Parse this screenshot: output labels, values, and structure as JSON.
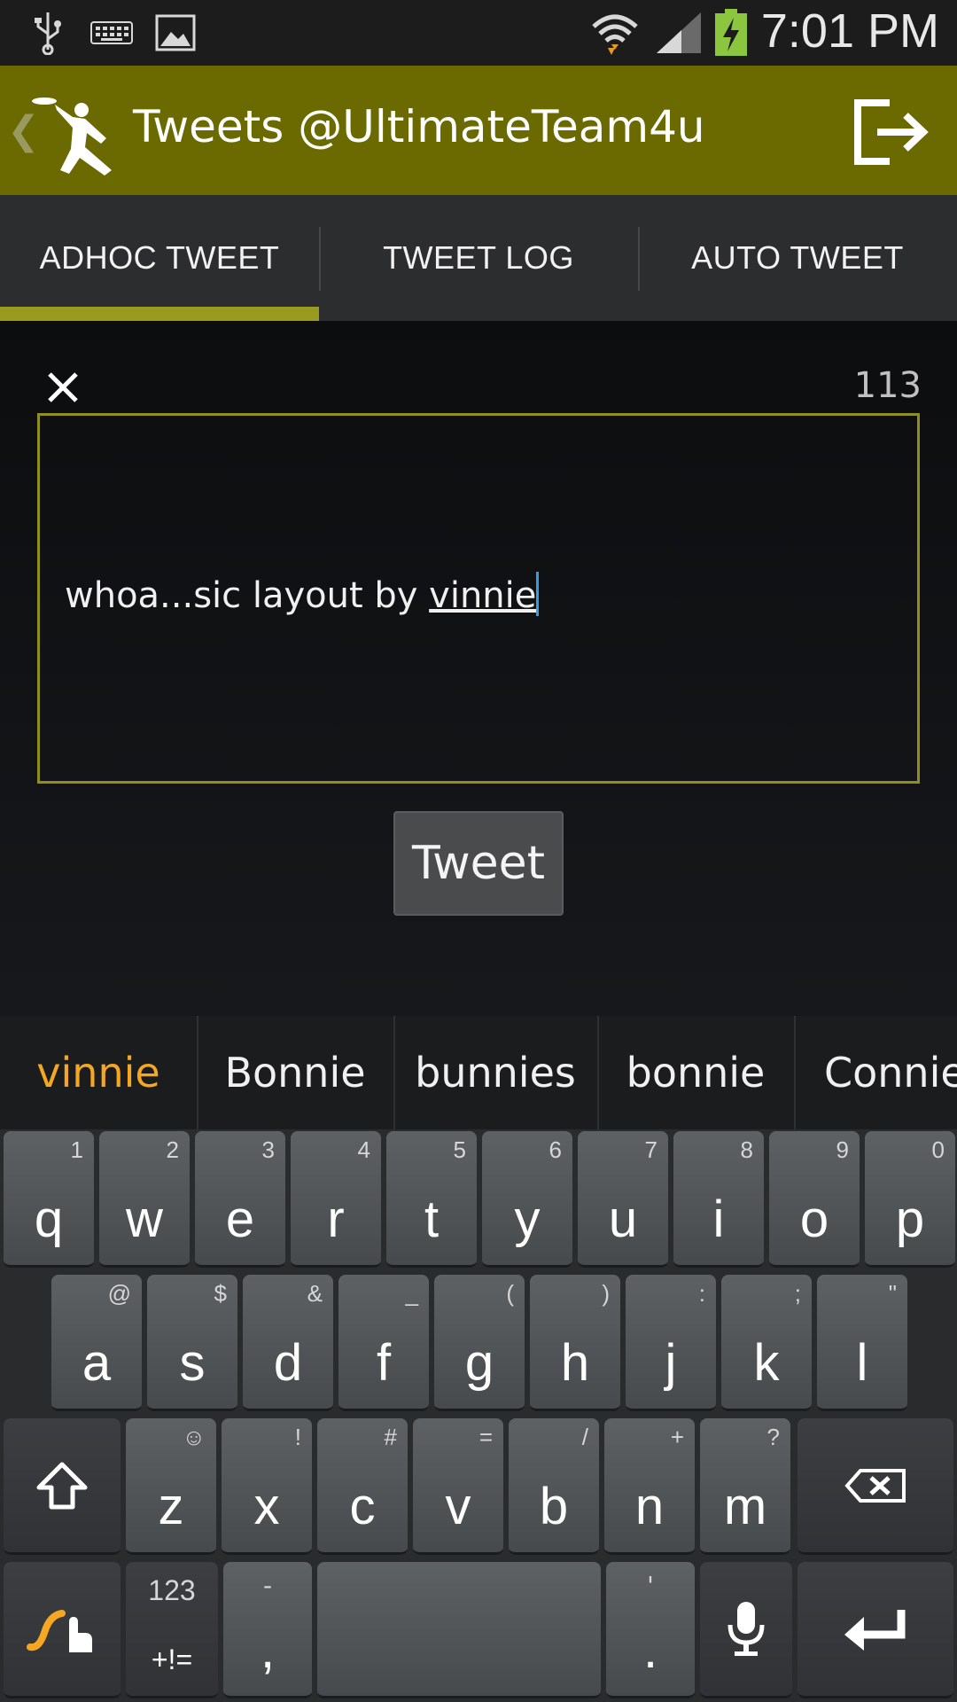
{
  "status_bar": {
    "time": "7:01 PM",
    "icons": [
      "usb-icon",
      "keyboard-icon",
      "image-icon",
      "wifi-icon",
      "signal-icon",
      "battery-charging-icon"
    ]
  },
  "action_bar": {
    "title": "Tweets @UltimateTeam4u",
    "back_icon": "chevron-left-icon",
    "logo_icon": "ultimate-frisbee-player-icon",
    "exit_icon": "logout-icon"
  },
  "tabs": [
    {
      "label": "ADHOC TWEET",
      "selected": true
    },
    {
      "label": "TWEET LOG",
      "selected": false
    },
    {
      "label": "AUTO TWEET",
      "selected": false
    }
  ],
  "composer": {
    "remaining_chars": "113",
    "text_plain": "whoa...sic layout by ",
    "text_composing": "vinnie",
    "tweet_button": "Tweet",
    "accent": "#8f8f1d"
  },
  "suggestions": [
    "vinnie",
    "Bonnie",
    "bunnies",
    "bonnie",
    "Connie"
  ],
  "keyboard": {
    "row1": [
      {
        "k": "q",
        "a": "1"
      },
      {
        "k": "w",
        "a": "2"
      },
      {
        "k": "e",
        "a": "3"
      },
      {
        "k": "r",
        "a": "4"
      },
      {
        "k": "t",
        "a": "5"
      },
      {
        "k": "y",
        "a": "6"
      },
      {
        "k": "u",
        "a": "7"
      },
      {
        "k": "i",
        "a": "8"
      },
      {
        "k": "o",
        "a": "9"
      },
      {
        "k": "p",
        "a": "0"
      }
    ],
    "row2": [
      {
        "k": "a",
        "a": "@"
      },
      {
        "k": "s",
        "a": "$"
      },
      {
        "k": "d",
        "a": "&"
      },
      {
        "k": "f",
        "a": "_"
      },
      {
        "k": "g",
        "a": "("
      },
      {
        "k": "h",
        "a": ")"
      },
      {
        "k": "j",
        "a": ":"
      },
      {
        "k": "k",
        "a": ";"
      },
      {
        "k": "l",
        "a": "\""
      }
    ],
    "row3": [
      {
        "k": "z",
        "a": "☺"
      },
      {
        "k": "x",
        "a": "!"
      },
      {
        "k": "c",
        "a": "#"
      },
      {
        "k": "v",
        "a": "="
      },
      {
        "k": "b",
        "a": "/"
      },
      {
        "k": "n",
        "a": "+"
      },
      {
        "k": "m",
        "a": "?"
      }
    ],
    "sym_top": "123",
    "sym_bottom": "+!=",
    "comma": ",",
    "comma_alt": "-",
    "period": ".",
    "period_alt": "'",
    "accent": "#f5a623"
  }
}
